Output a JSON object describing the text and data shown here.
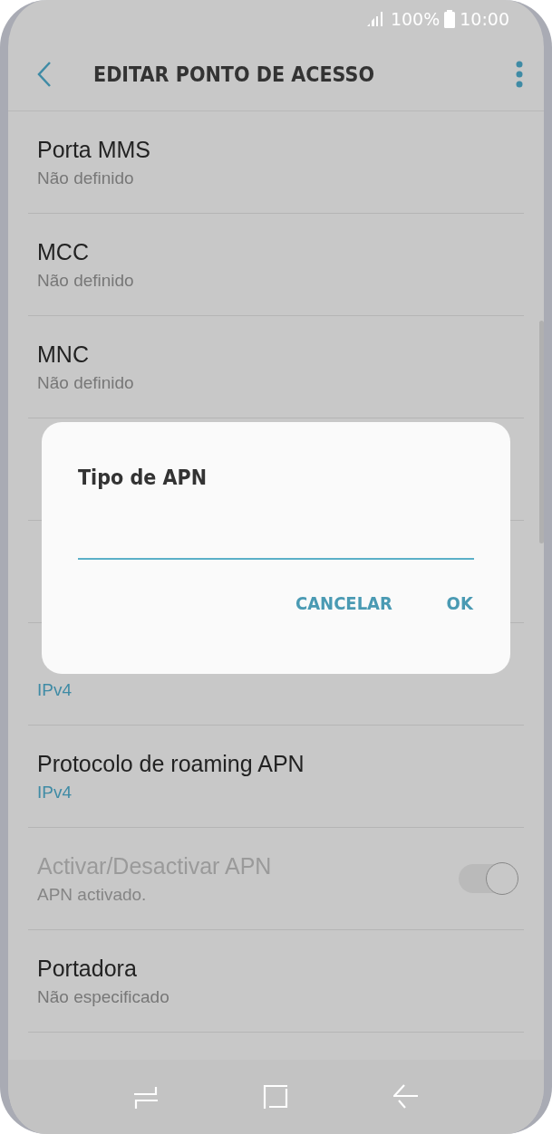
{
  "status_bar": {
    "battery": "100%",
    "time": "10:00"
  },
  "toolbar": {
    "title": "EDITAR PONTO DE ACESSO"
  },
  "settings": [
    {
      "kind": "text",
      "title": "Porta MMS",
      "value": "Não definido",
      "accent": false
    },
    {
      "kind": "text",
      "title": "MCC",
      "value": "Não definido",
      "accent": false
    },
    {
      "kind": "text",
      "title": "MNC",
      "value": "Não definido",
      "accent": false
    },
    {
      "kind": "hidden"
    },
    {
      "kind": "hidden"
    },
    {
      "kind": "text",
      "value": "IPv4",
      "accent": true
    },
    {
      "kind": "text",
      "title": "Protocolo de roaming APN",
      "value": "IPv4",
      "accent": true
    },
    {
      "kind": "toggle",
      "title": "Activar/Desactivar APN",
      "value": "APN activado.",
      "on": true,
      "disabled": true
    },
    {
      "kind": "text",
      "title": "Portadora",
      "value": "Não especificado",
      "accent": false
    }
  ],
  "dialog": {
    "title": "Tipo de APN",
    "buttons": [
      "CANCELAR",
      "OK"
    ]
  }
}
